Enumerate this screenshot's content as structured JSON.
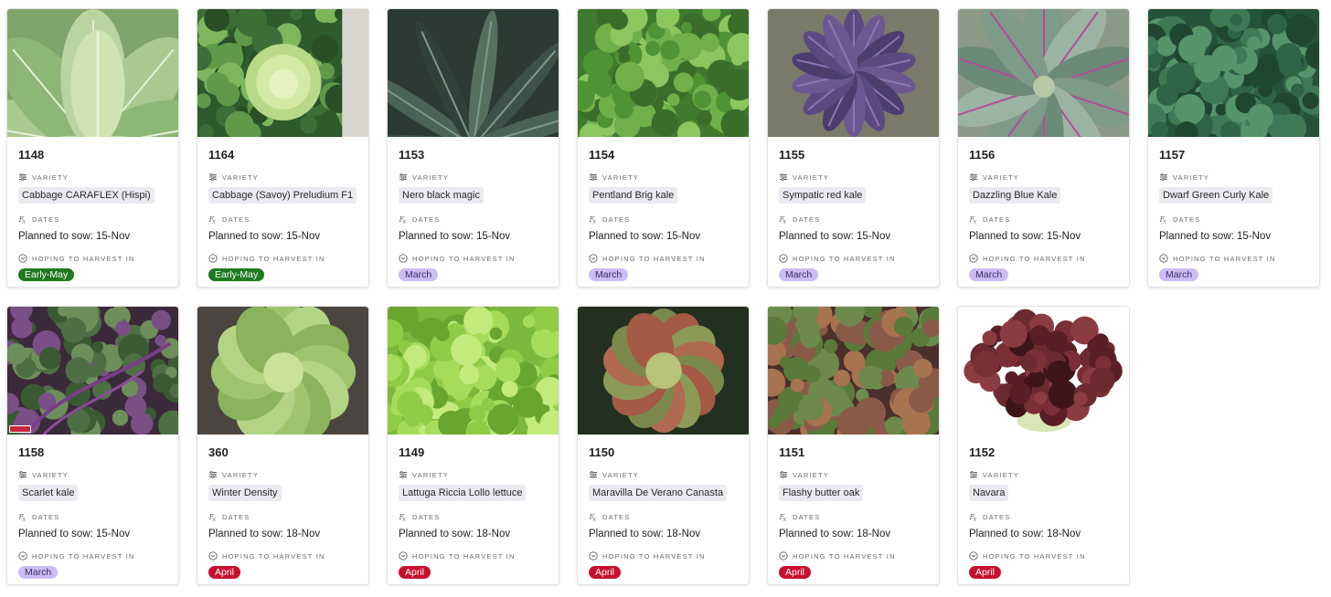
{
  "labels": {
    "variety": "VARIETY",
    "dates": "DATES",
    "harvest": "HOPING TO HARVEST IN"
  },
  "icons": {
    "variety": "list-settings-icon",
    "dates": "formula-icon",
    "harvest": "chevron-circle-icon"
  },
  "harvest_colors": {
    "Early-May": {
      "bg": "#1f7a1f",
      "fg": "#ffffff"
    },
    "March": {
      "bg": "#cbbdf4",
      "fg": "#3b2a6b"
    },
    "April": {
      "bg": "#c8102e",
      "fg": "#ffffff"
    }
  },
  "cards": [
    {
      "id": "1148",
      "variety": "Cabbage CARAFLEX (Hispi)",
      "dates": "Planned to sow: 15-Nov",
      "harvest": "Early-May",
      "image": "pointed green cabbage"
    },
    {
      "id": "1164",
      "variety": "Cabbage (Savoy) Preludium F1",
      "dates": "Planned to sow: 15-Nov",
      "harvest": "Early-May",
      "image": "savoy cabbage"
    },
    {
      "id": "1153",
      "variety": "Nero black magic",
      "dates": "Planned to sow: 15-Nov",
      "harvest": "March",
      "image": "dark cavolo nero leaves"
    },
    {
      "id": "1154",
      "variety": "Pentland Brig kale",
      "dates": "Planned to sow: 15-Nov",
      "harvest": "March",
      "image": "curly green kale"
    },
    {
      "id": "1155",
      "variety": "Sympatic red kale",
      "dates": "Planned to sow: 15-Nov",
      "harvest": "March",
      "image": "purple kale"
    },
    {
      "id": "1156",
      "variety": "Dazzling Blue Kale",
      "dates": "Planned to sow: 15-Nov",
      "harvest": "March",
      "image": "blue kale with pink veins"
    },
    {
      "id": "1157",
      "variety": "Dwarf Green Curly Kale",
      "dates": "Planned to sow: 15-Nov",
      "harvest": "March",
      "image": "dense green curly kale"
    },
    {
      "id": "1158",
      "variety": "Scarlet kale",
      "dates": "Planned to sow: 15-Nov",
      "harvest": "March",
      "image": "scarlet kale with purple stems"
    },
    {
      "id": "360",
      "variety": "Winter Density",
      "dates": "Planned to sow: 18-Nov",
      "harvest": "April",
      "image": "butterhead lettuce"
    },
    {
      "id": "1149",
      "variety": "Lattuga Riccia Lollo lettuce",
      "dates": "Planned to sow: 18-Nov",
      "harvest": "April",
      "image": "frilly bright green lettuce"
    },
    {
      "id": "1150",
      "variety": "Maravilla De Verano Canasta",
      "dates": "Planned to sow: 18-Nov",
      "harvest": "April",
      "image": "red tinged lettuce"
    },
    {
      "id": "1151",
      "variety": "Flashy butter oak",
      "dates": "Planned to sow: 18-Nov",
      "harvest": "April",
      "image": "speckled red lettuce"
    },
    {
      "id": "1152",
      "variety": "Navara",
      "dates": "Planned to sow: 18-Nov",
      "harvest": "April",
      "image": "dark red oak leaf lettuce"
    }
  ]
}
